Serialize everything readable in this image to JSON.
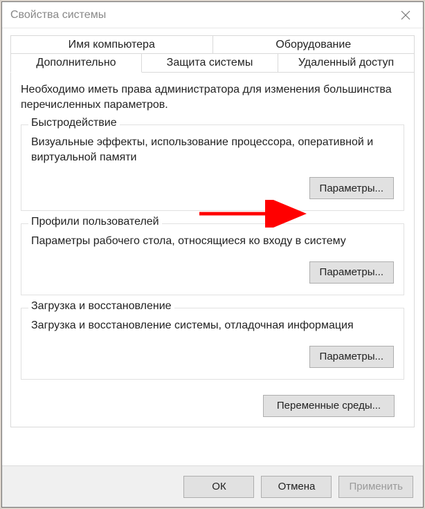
{
  "window": {
    "title": "Свойства системы"
  },
  "tabs": {
    "row1": [
      {
        "label": "Имя компьютера"
      },
      {
        "label": "Оборудование"
      }
    ],
    "row2": [
      {
        "label": "Дополнительно",
        "active": true
      },
      {
        "label": "Защита системы"
      },
      {
        "label": "Удаленный доступ"
      }
    ]
  },
  "intro": "Необходимо иметь права администратора для изменения большинства перечисленных параметров.",
  "groups": {
    "performance": {
      "legend": "Быстродействие",
      "desc": "Визуальные эффекты, использование процессора, оперативной и виртуальной памяти",
      "button": "Параметры..."
    },
    "profiles": {
      "legend": "Профили пользователей",
      "desc": "Параметры рабочего стола, относящиеся ко входу в систему",
      "button": "Параметры..."
    },
    "startup": {
      "legend": "Загрузка и восстановление",
      "desc": "Загрузка и восстановление системы, отладочная информация",
      "button": "Параметры..."
    }
  },
  "env_button": "Переменные среды...",
  "footer": {
    "ok": "ОК",
    "cancel": "Отмена",
    "apply": "Применить"
  },
  "annotation": {
    "arrow_color": "#ff0000"
  }
}
